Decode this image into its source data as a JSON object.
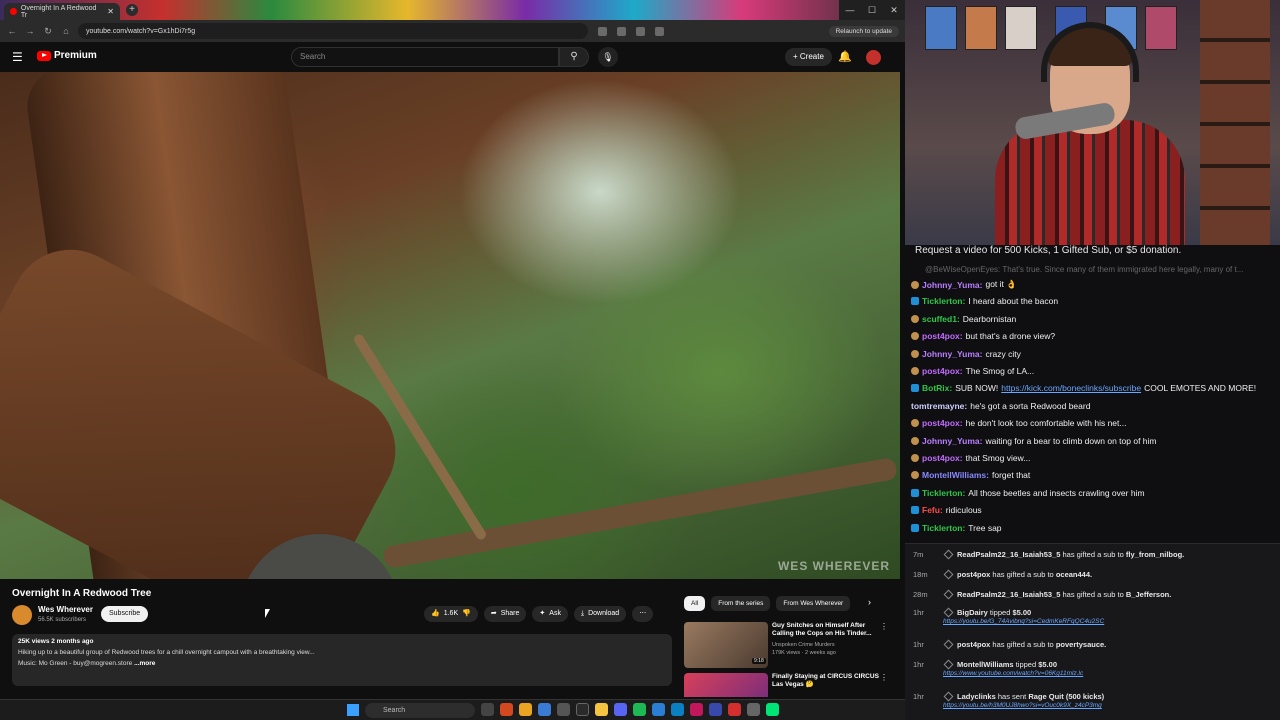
{
  "browser": {
    "tab_title": "Overnight In A Redwood Tr",
    "url": "youtube.com/watch?v=Gx1hDi7r5g",
    "relaunch": "Relaunch to update"
  },
  "youtube": {
    "brand": "Premium",
    "search_placeholder": "Search",
    "create_label": "Create",
    "video_watermark": "WES WHEREVER",
    "video_title": "Overnight In A Redwood Tree",
    "channel_name": "Wes Wherever",
    "channel_subs": "56.5K subscribers",
    "subscribe_label": "Subscribe",
    "actions": {
      "likes": "1.6K",
      "share": "Share",
      "ask": "Ask",
      "download": "Download"
    },
    "description": {
      "meta": "25K views  2 months ago",
      "line1": "Hiking up to a beautiful group of Redwood trees for a chill overnight campout with a breathtaking view...",
      "line2": "Music: Mo Green - buy@mogreen.store",
      "more": "...more"
    },
    "chips": [
      "All",
      "From the series",
      "From Wes Wherever"
    ],
    "recommendations": [
      {
        "title": "Guy Snitches on Himself After Calling the Cops on His Tinder...",
        "channel": "Unspoken Crime Murders",
        "views": "179K views · 2 weeks ago",
        "duration": "9:18",
        "thumb_color": "#8a6f5a"
      },
      {
        "title": "Finally Staying at CIRCUS CIRCUS Las Vegas 🤔",
        "channel": "",
        "views": "",
        "duration": "",
        "thumb_color": "#c23a5a"
      }
    ]
  },
  "taskbar": {
    "search_label": "Search"
  },
  "chat": {
    "banner": "Request a video for 500 Kicks, 1 Gifted Sub, or $5 donation.",
    "faded_line": "@BeWiseOpenEyes: That's true. Since many of them immigrated here legally, many of t...",
    "messages": [
      {
        "user": "Johnny_Yuma:",
        "text": "got it 👌",
        "color": "#b97fff",
        "badge": "bronze"
      },
      {
        "user": "Ticklerton:",
        "text": "I heard about the bacon",
        "color": "#31c748",
        "badge": "blue"
      },
      {
        "user": "scuffed1:",
        "text": "Dearbornistan",
        "color": "#31c748",
        "badge": "bronze"
      },
      {
        "user": "post4pox:",
        "text": "but that's a drone view?",
        "color": "#c26bff",
        "badge": "bronze"
      },
      {
        "user": "Johnny_Yuma:",
        "text": "crazy city",
        "color": "#b97fff",
        "badge": "bronze"
      },
      {
        "user": "post4pox:",
        "text": "The Smog of LA...",
        "color": "#c26bff",
        "badge": "bronze"
      },
      {
        "user": "BotRix:",
        "text": "SUB NOW!",
        "link": "https://kick.com/boneclinks/subscribe",
        "tail": "COOL EMOTES AND MORE!",
        "color": "#31c748",
        "badge": "blue"
      },
      {
        "user": "tomtremayne:",
        "text": "he's got a sorta Redwood beard",
        "color": "#cfcfff",
        "badge": "none"
      },
      {
        "user": "post4pox:",
        "text": "he don't look too comfortable with his net...",
        "color": "#c26bff",
        "badge": "bronze"
      },
      {
        "user": "Johnny_Yuma:",
        "text": "waiting for a bear to climb down on top of him",
        "color": "#b97fff",
        "badge": "bronze"
      },
      {
        "user": "post4pox:",
        "text": "that Smog view...",
        "color": "#c26bff",
        "badge": "bronze"
      },
      {
        "user": "MontellWilliams:",
        "text": "forget that",
        "color": "#8a8aff",
        "badge": "bronze"
      },
      {
        "user": "Ticklerton:",
        "text": "All those beetles and insects crawling over him",
        "color": "#31c748",
        "badge": "blue"
      },
      {
        "user": "Fefu:",
        "text": "ridiculous",
        "color": "#ff4b4b",
        "badge": "blue"
      },
      {
        "user": "Ticklerton:",
        "text": "Tree sap",
        "color": "#31c748",
        "badge": "blue"
      }
    ]
  },
  "events": [
    {
      "time": "7m",
      "user": "ReadPsalm22_16_Isaiah53_5",
      "action": "has gifted a sub to",
      "target": "fly_from_nilbog.",
      "link": ""
    },
    {
      "time": "18m",
      "user": "post4pox",
      "action": "has gifted a sub to",
      "target": "ocean444.",
      "link": ""
    },
    {
      "time": "28m",
      "user": "ReadPsalm22_16_Isaiah53_5",
      "action": "has gifted a sub to",
      "target": "B_Jefferson.",
      "link": ""
    },
    {
      "time": "1hr",
      "user": "BigDairy",
      "action": "tipped",
      "target": "$5.00",
      "link": "https://youtu.be/G_74Avibnq?si=CedmKeRFqQC4u2SC"
    },
    {
      "time": "1hr",
      "user": "post4pox",
      "action": "has gifted a sub to",
      "target": "povertysauce.",
      "link": ""
    },
    {
      "time": "1hr",
      "user": "MontellWilliams",
      "action": "tipped",
      "target": "$5.00",
      "link": "https://www.youtube.com/watch?v=06Kg11mlz.lc"
    },
    {
      "time": "1hr",
      "user": "Ladyclinks",
      "action": "has sent",
      "target": "Rage Quit (500 kicks)",
      "link": "https://youtu.be/h3M0UJ8hwo?si=vOuc0k9X_z4cP3mg"
    }
  ]
}
